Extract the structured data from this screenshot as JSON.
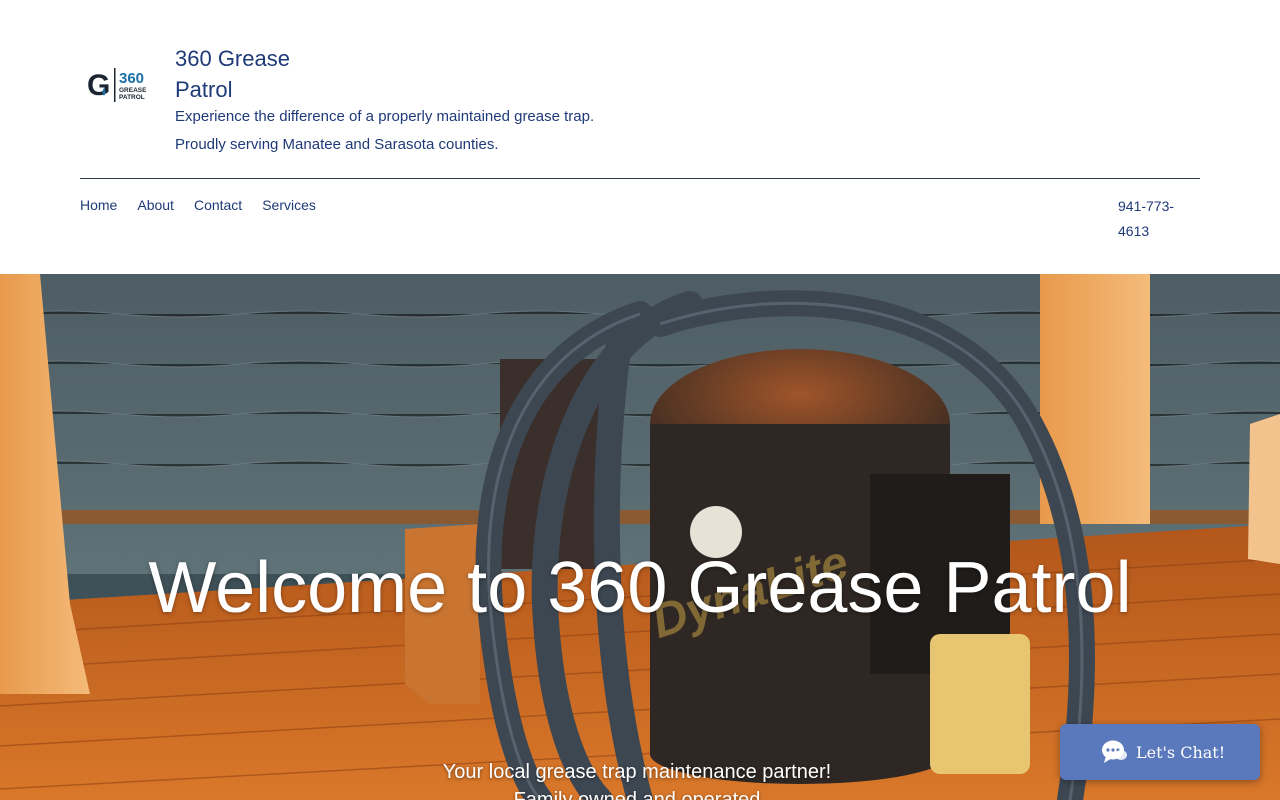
{
  "header": {
    "logo_text": "360",
    "logo_subtext": "GREASE PATROL",
    "site_title": "360 Grease Patrol",
    "tagline_1": "Experience the difference of a properly maintained grease trap.",
    "tagline_2": "Proudly serving Manatee and Sarasota counties.",
    "phone": "941-773-4613"
  },
  "nav": {
    "items": [
      {
        "label": "Home"
      },
      {
        "label": "About"
      },
      {
        "label": "Contact"
      },
      {
        "label": "Services"
      }
    ]
  },
  "hero": {
    "title": "Welcome to 360 Grease Patrol",
    "subtitle": "Your local grease trap maintenance partner!",
    "subtitle_2": "Family owned and operated"
  },
  "chat": {
    "label": "Let's Chat!"
  },
  "colors": {
    "brand_text": "#1f3a78",
    "logo_blue": "#1a6fa8",
    "chat_bg": "#5a79bd",
    "deck_orange": "#c8641c"
  },
  "icons": {
    "chat": "chat-bubble-icon"
  }
}
